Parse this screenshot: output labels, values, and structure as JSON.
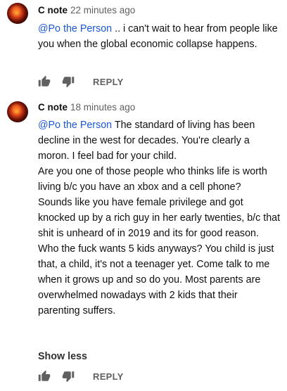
{
  "comments": [
    {
      "author": "C note",
      "time": "22 minutes ago",
      "mention": "@Po the Person",
      "text": " .. i can't wait to hear from people like you when the global economic collapse happens.",
      "reply_label": "REPLY",
      "icons": {
        "like": "thumbs-up-icon",
        "dislike": "thumbs-down-icon"
      }
    },
    {
      "author": "C note",
      "time": "18 minutes ago",
      "mention": "@Po the Person",
      "text_first": " The standard of living has been decline in the west for decades.  You're clearly a moron.  I feel bad for your child.",
      "paragraphs": [
        "Are you one of those people who thinks life is worth living b/c you have an xbox and a cell phone?",
        "Sounds like you have female privilege and got knocked up by a rich guy in her early twenties, b/c that shit is unheard of in 2019 and its for good reason.",
        "Who the fuck wants 5 kids anyways?  You child is just that, a child, it's not a teenager yet.  Come talk to me when it grows up and so do you.  Most parents are overwhelmed nowadays with 2 kids that their parenting suffers."
      ],
      "show_less_label": "Show less",
      "reply_label": "REPLY",
      "icons": {
        "like": "thumbs-up-icon",
        "dislike": "thumbs-down-icon"
      }
    }
  ],
  "colors": {
    "mention": "#1a57d6",
    "secondary_text": "#606060"
  }
}
